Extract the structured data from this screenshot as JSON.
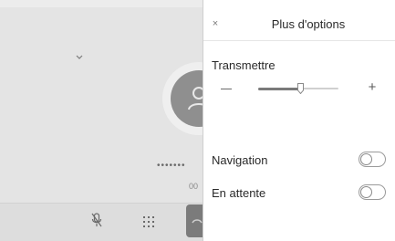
{
  "call_screen": {
    "masked_number": "•••••••",
    "timer": "00",
    "icons": {
      "collapse": "chevron-down-icon",
      "avatar": "person-icon",
      "mute": "mic-muted-icon",
      "keypad": "keypad-icon",
      "end_call": "phone-hangup-icon"
    }
  },
  "options_panel": {
    "close_icon": "×",
    "title": "Plus d'options",
    "transmit": {
      "label": "Transmettre",
      "minus": "–",
      "plus": "+",
      "level": 0.52
    },
    "toggles": [
      {
        "label": "Navigation",
        "on": false
      },
      {
        "label": "En attente",
        "on": false
      }
    ]
  }
}
